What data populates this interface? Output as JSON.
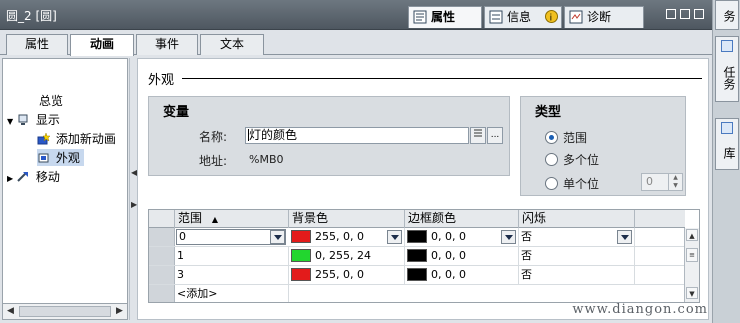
{
  "window": {
    "title": "圆_2 [圆]"
  },
  "inspector_tabs": [
    {
      "label": "属性",
      "active": true
    },
    {
      "label": "信息"
    },
    {
      "label": "诊断"
    }
  ],
  "side_tabs": [
    "任务",
    "库"
  ],
  "side_top_partial": "务",
  "sub_tabs": [
    {
      "label": "属性"
    },
    {
      "label": "动画",
      "active": true
    },
    {
      "label": "事件"
    },
    {
      "label": "文本"
    }
  ],
  "nav": {
    "overview": "总览",
    "display": "显示",
    "add_animation": "添加新动画",
    "appearance": "外观",
    "movement": "移动"
  },
  "panel": {
    "section_title": "外观",
    "variable_group": {
      "title": "变量",
      "name_label": "名称:",
      "name_value": "灯的颜色",
      "address_label": "地址:",
      "address_value": "%MB0",
      "browse_btn": "..."
    },
    "type_group": {
      "title": "类型",
      "options": [
        {
          "label": "范围",
          "selected": true
        },
        {
          "label": "多个位",
          "selected": false
        },
        {
          "label": "单个位",
          "selected": false
        }
      ],
      "bit_value": "0"
    }
  },
  "grid": {
    "columns": [
      "范围",
      "背景色",
      "边框颜色",
      "闪烁"
    ],
    "rows": [
      {
        "range": "0",
        "bg_color": "#e31b1b",
        "bg_text": "255, 0, 0",
        "border_color": "#000000",
        "border_text": "0, 0, 0",
        "flash": "否"
      },
      {
        "range": "1",
        "bg_color": "#22d62f",
        "bg_text": "0, 255, 24",
        "border_color": "#000000",
        "border_text": "0, 0, 0",
        "flash": "否"
      },
      {
        "range": "3",
        "bg_color": "#e31b1b",
        "bg_text": "255, 0, 0",
        "border_color": "#000000",
        "border_text": "0, 0, 0",
        "flash": "否"
      }
    ],
    "add_row": "<添加>"
  },
  "watermark": "www.diangon.com"
}
